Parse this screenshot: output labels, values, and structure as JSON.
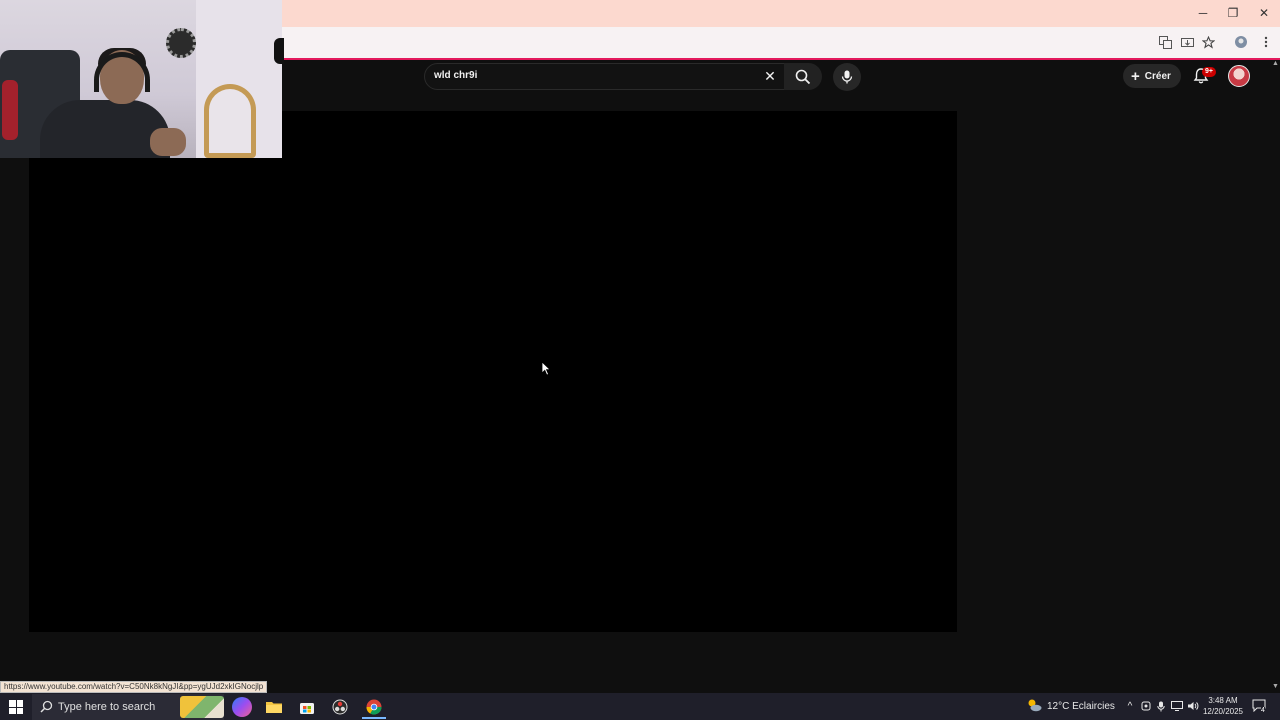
{
  "browser": {
    "minimize": "─",
    "restore": "❐",
    "close": "✕",
    "toolbar_icons": [
      "translate-icon",
      "install-icon",
      "star-icon",
      "extension-icon",
      "menu-icon"
    ]
  },
  "youtube": {
    "search_query": "wld chr9i",
    "create_label": "Créer",
    "notification_badge": "9+",
    "accent_color": "#e3195c"
  },
  "status_url": "https://www.youtube.com/watch?v=C50Nk8kNgJI&pp=ygUJd2xkIGNocjlp",
  "taskbar": {
    "search_placeholder": "Type here to search",
    "weather": "12°C  Eclaircies",
    "time": "3:48 AM",
    "date": "12/20/2025",
    "notification_count": "4"
  }
}
